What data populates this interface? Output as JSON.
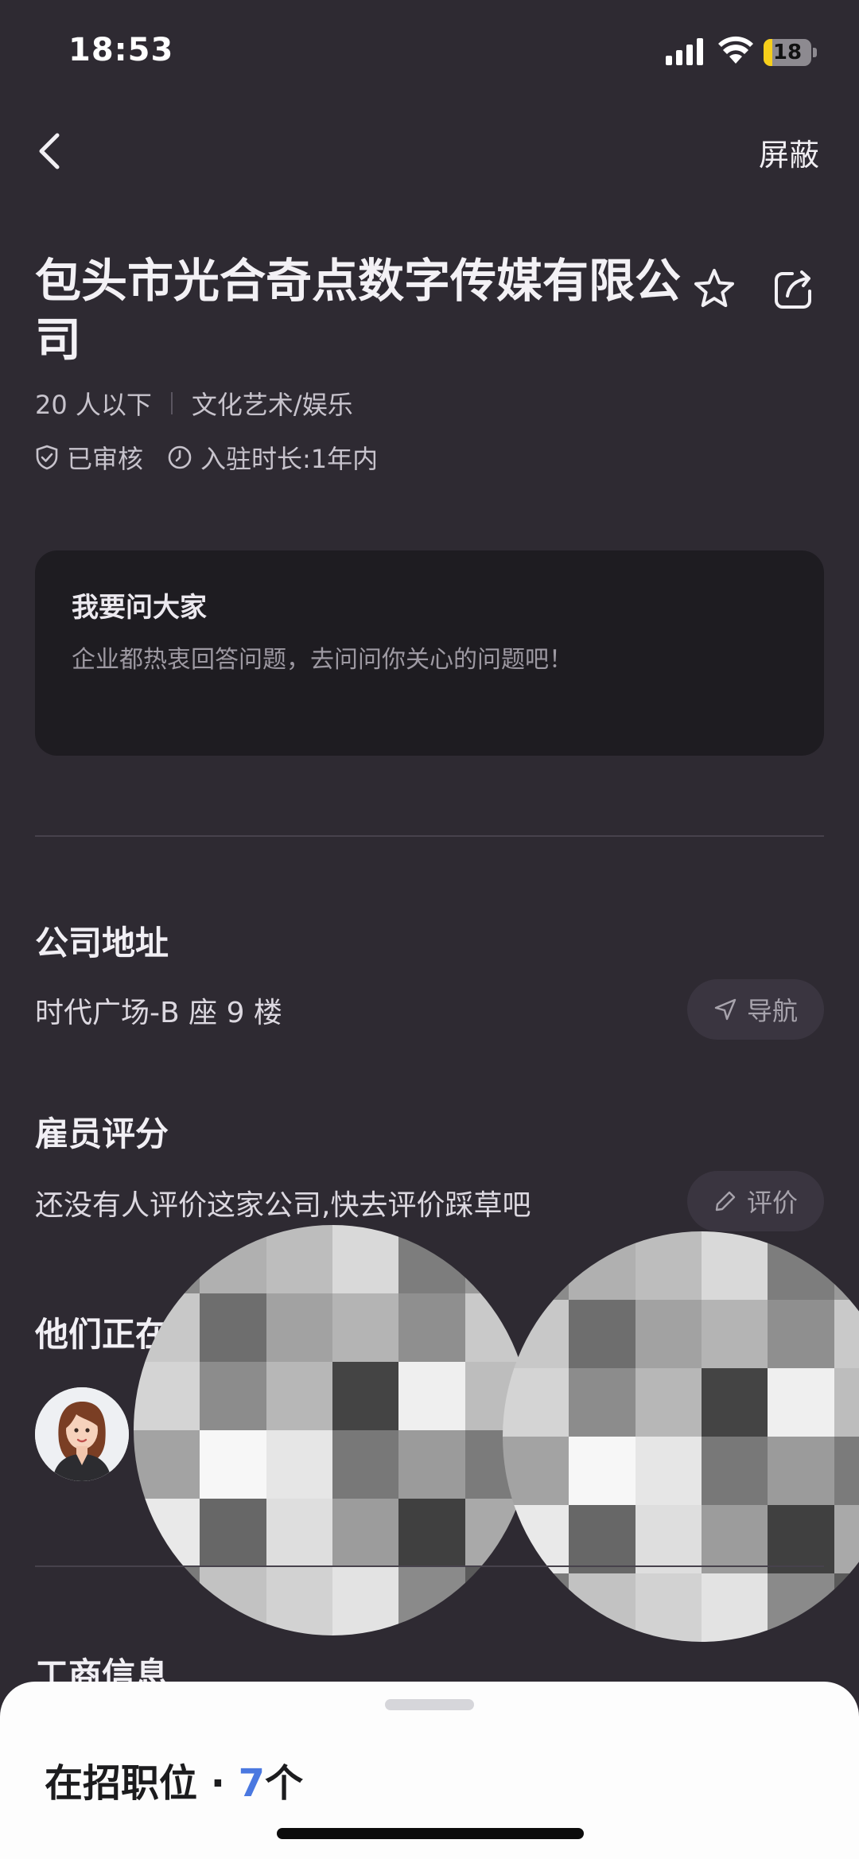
{
  "status_bar": {
    "time": "18:53",
    "battery_level": "18",
    "battery_fraction": 0.18
  },
  "nav": {
    "back_icon": "chevron-left-icon",
    "block_label": "屏蔽"
  },
  "company": {
    "name": "包头市光合奇点数字传媒有限公司",
    "size": "20 人以下",
    "industry": "文化艺术/娱乐",
    "verified_label": "已审核",
    "tenure_label": "入驻时长:1年内"
  },
  "ask": {
    "title": "我要问大家",
    "subtitle": "企业都热衷回答问题，去问问你关心的问题吧！"
  },
  "address": {
    "title": "公司地址",
    "value": "时代广场-B 座 9 楼",
    "nav_label": "导航"
  },
  "rating": {
    "title": "雇员评分",
    "empty_text": "还没有人评价这家公司,快去评价踩草吧",
    "rate_label": "评价"
  },
  "recruiters": {
    "title": "他们正在"
  },
  "business_info": {
    "title": "工商信息"
  },
  "jobs_sheet": {
    "label": "在招职位 · ",
    "count": "7",
    "unit": "个"
  },
  "colors": {
    "background": "#2e2a32",
    "card": "#1e1c21",
    "accent_blue": "#4a78e0",
    "battery": "#f7cf1a"
  }
}
